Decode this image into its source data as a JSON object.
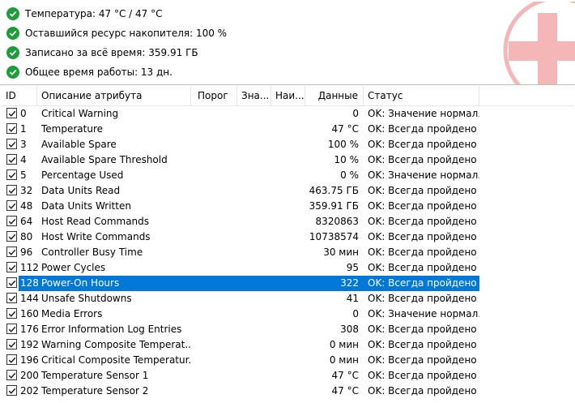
{
  "summary": {
    "temperature": "Температура: 47 °C / 47 °C",
    "remaining": "Оставшийся ресурс накопителя: 100 %",
    "written": "Записано за всё время: 359.91 ГБ",
    "uptime": "Общее время работы: 13 дн."
  },
  "colors": {
    "ok": "#1e9e3a",
    "selection": "#0078d7",
    "logo": "#f4b6b6"
  },
  "table": {
    "headers": {
      "id": "ID",
      "desc": "Описание атрибута",
      "threshold": "Порог",
      "value": "Зна...",
      "worst": "Наи...",
      "data": "Данные",
      "status": "Статус"
    },
    "rows": [
      {
        "id": "0",
        "desc": "Critical Warning",
        "data": "0",
        "status": "OK: Значение нормал..."
      },
      {
        "id": "1",
        "desc": "Temperature",
        "data": "47 °C",
        "status": "OK: Всегда пройдено"
      },
      {
        "id": "3",
        "desc": "Available Spare",
        "data": "100 %",
        "status": "OK: Всегда пройдено"
      },
      {
        "id": "4",
        "desc": "Available Spare Threshold",
        "data": "10 %",
        "status": "OK: Всегда пройдено"
      },
      {
        "id": "5",
        "desc": "Percentage Used",
        "data": "0 %",
        "status": "OK: Значение нормал..."
      },
      {
        "id": "32",
        "desc": "Data Units Read",
        "data": "463.75 ГБ",
        "status": "OK: Всегда пройдено"
      },
      {
        "id": "48",
        "desc": "Data Units Written",
        "data": "359.91 ГБ",
        "status": "OK: Всегда пройдено"
      },
      {
        "id": "64",
        "desc": "Host Read Commands",
        "data": "8320863",
        "status": "OK: Всегда пройдено"
      },
      {
        "id": "80",
        "desc": "Host Write Commands",
        "data": "10738574",
        "status": "OK: Всегда пройдено"
      },
      {
        "id": "96",
        "desc": "Controller Busy Time",
        "data": "30 мин",
        "status": "OK: Всегда пройдено"
      },
      {
        "id": "112",
        "desc": "Power Cycles",
        "data": "95",
        "status": "OK: Всегда пройдено"
      },
      {
        "id": "128",
        "desc": "Power-On Hours",
        "data": "322",
        "status": "OK: Всегда пройдено",
        "selected": true
      },
      {
        "id": "144",
        "desc": "Unsafe Shutdowns",
        "data": "41",
        "status": "OK: Всегда пройдено"
      },
      {
        "id": "160",
        "desc": "Media Errors",
        "data": "0",
        "status": "OK: Значение нормал..."
      },
      {
        "id": "176",
        "desc": "Error Information Log Entries",
        "data": "308",
        "status": "OK: Всегда пройдено"
      },
      {
        "id": "192",
        "desc": "Warning Composite Temperat...",
        "data": "0 мин",
        "status": "OK: Всегда пройдено"
      },
      {
        "id": "196",
        "desc": "Critical Composite Temperatur...",
        "data": "0 мин",
        "status": "OK: Всегда пройдено"
      },
      {
        "id": "200",
        "desc": "Temperature Sensor 1",
        "data": "47 °C",
        "status": "OK: Всегда пройдено"
      },
      {
        "id": "202",
        "desc": "Temperature Sensor 2",
        "data": "47 °C",
        "status": "OK: Всегда пройдено"
      }
    ]
  }
}
